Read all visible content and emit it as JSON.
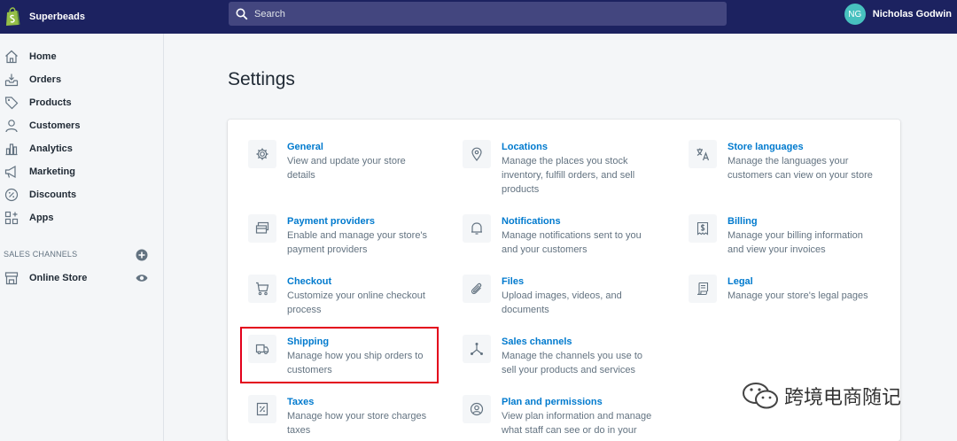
{
  "topbar": {
    "brand": "Superbeads",
    "search_placeholder": "Search",
    "avatar_initials": "NG",
    "user_name": "Nicholas Godwin"
  },
  "sidebar": {
    "items": [
      {
        "label": "Home",
        "icon": "home-icon"
      },
      {
        "label": "Orders",
        "icon": "orders-icon"
      },
      {
        "label": "Products",
        "icon": "products-icon"
      },
      {
        "label": "Customers",
        "icon": "customers-icon"
      },
      {
        "label": "Analytics",
        "icon": "analytics-icon"
      },
      {
        "label": "Marketing",
        "icon": "marketing-icon"
      },
      {
        "label": "Discounts",
        "icon": "discounts-icon"
      },
      {
        "label": "Apps",
        "icon": "apps-icon"
      }
    ],
    "sales_channels_title": "SALES CHANNELS",
    "online_store": "Online Store"
  },
  "main": {
    "title": "Settings",
    "settings": [
      {
        "title": "General",
        "desc1": "View and update your store",
        "desc2": "details",
        "desc3": ""
      },
      {
        "title": "Locations",
        "desc1": "Manage the places you stock",
        "desc2": "inventory, fulfill orders, and sell",
        "desc3": "products"
      },
      {
        "title": "Store languages",
        "desc1": "Manage the languages your",
        "desc2": "customers can view on your store",
        "desc3": ""
      },
      {
        "title": "Payment providers",
        "desc1": "Enable and manage your store's",
        "desc2": "payment providers",
        "desc3": ""
      },
      {
        "title": "Notifications",
        "desc1": "Manage notifications sent to you",
        "desc2": "and your customers",
        "desc3": ""
      },
      {
        "title": "Billing",
        "desc1": "Manage your billing information",
        "desc2": "and view your invoices",
        "desc3": ""
      },
      {
        "title": "Checkout",
        "desc1": "Customize your online checkout",
        "desc2": "process",
        "desc3": ""
      },
      {
        "title": "Files",
        "desc1": "Upload images, videos, and",
        "desc2": "documents",
        "desc3": ""
      },
      {
        "title": "Legal",
        "desc1": "Manage your store's legal pages",
        "desc2": "",
        "desc3": ""
      },
      {
        "title": "Shipping",
        "desc1": "Manage how you ship orders to",
        "desc2": "customers",
        "desc3": ""
      },
      {
        "title": "Sales channels",
        "desc1": "Manage the channels you use to",
        "desc2": "sell your products and services",
        "desc3": ""
      },
      {
        "title": "Taxes",
        "desc1": "Manage how your store charges",
        "desc2": "taxes",
        "desc3": ""
      },
      {
        "title": "Plan and permissions",
        "desc1": "View plan information and manage",
        "desc2": "what staff can see or do in your",
        "desc3": ""
      }
    ]
  },
  "watermark": "跨境电商随记",
  "colors": {
    "topbar": "#1c2260",
    "link": "#007ace",
    "highlight": "#e3001b"
  }
}
